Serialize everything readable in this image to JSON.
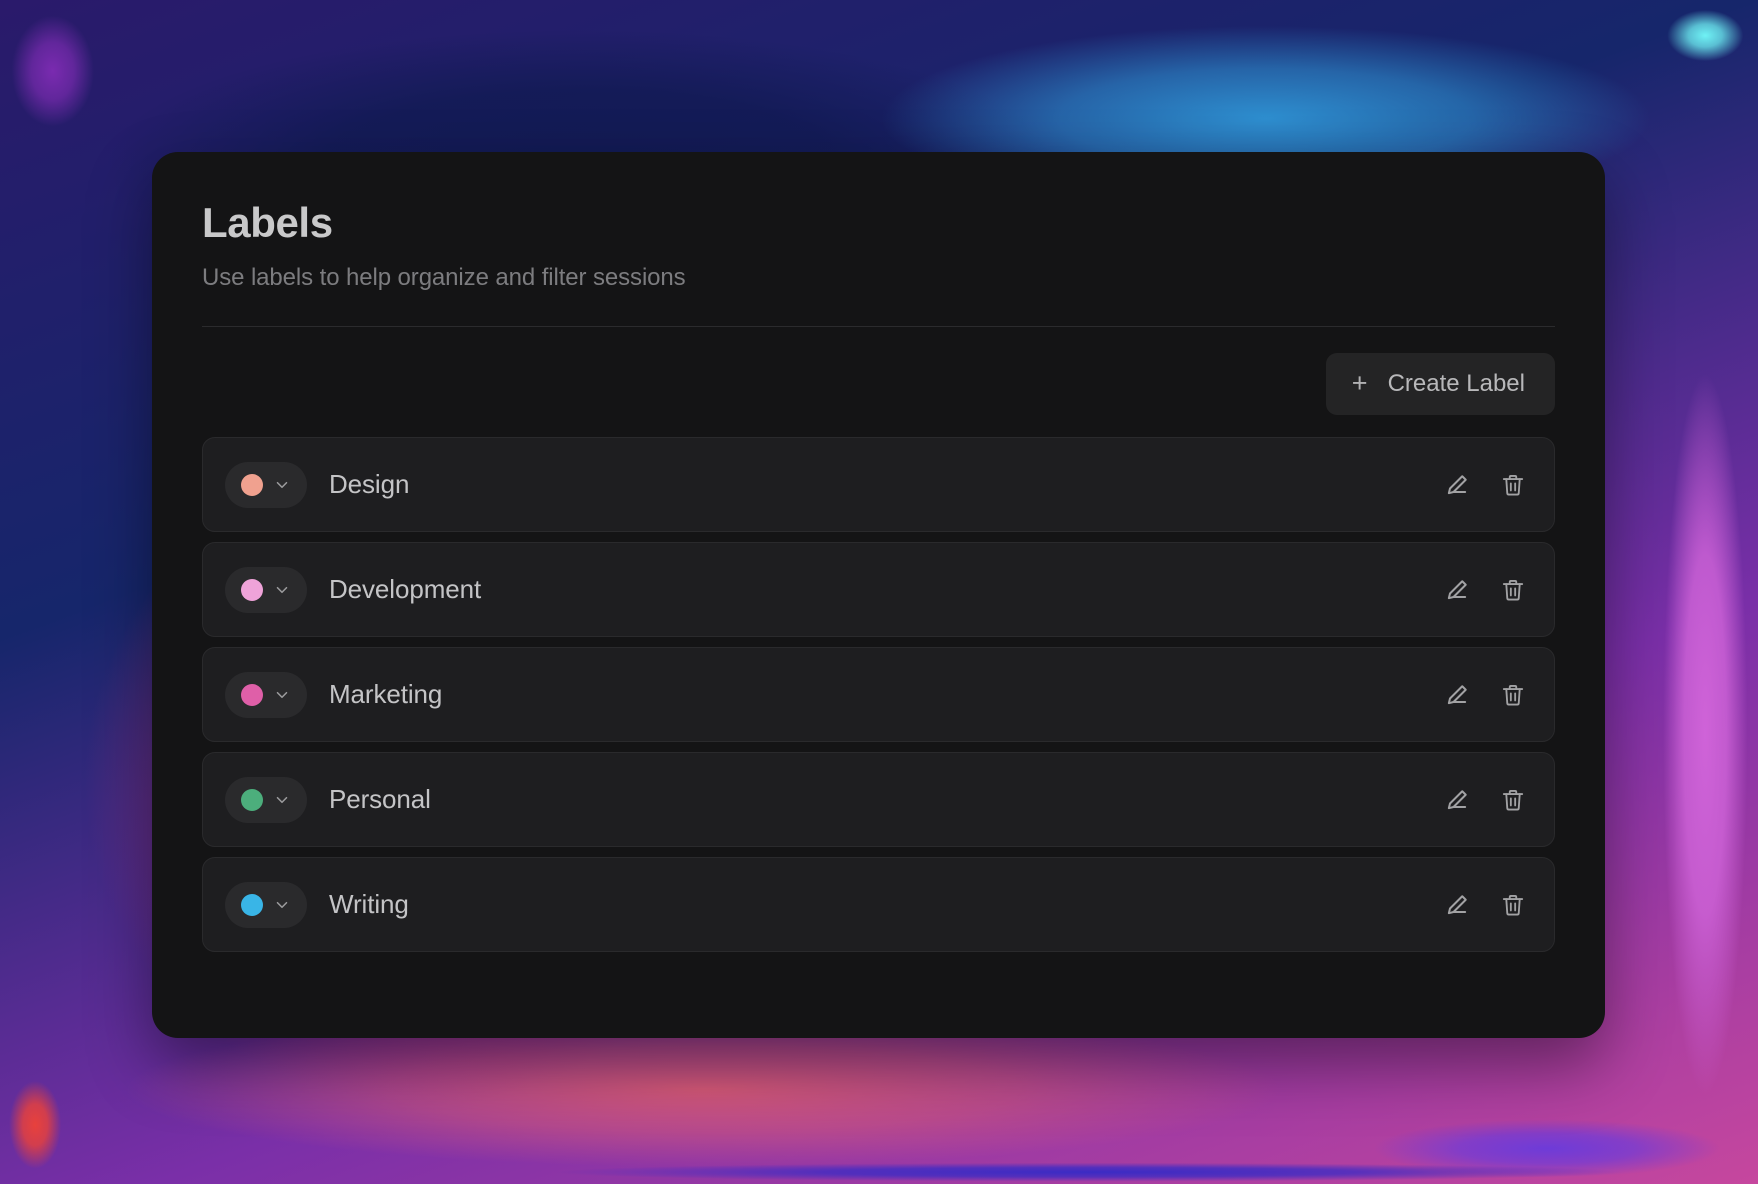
{
  "background": {
    "colors": [
      "#7a2bb0",
      "#121a54",
      "#6ff2f5",
      "#e8413c",
      "#cf63d8",
      "#3b2bc4"
    ]
  },
  "card": {
    "background_color": "#141415"
  },
  "header": {
    "title": "Labels",
    "subtitle": "Use labels to help organize and filter sessions"
  },
  "toolbar": {
    "create_label": {
      "label": "Create Label",
      "icon": "plus-icon",
      "icon_glyph": "+"
    }
  },
  "labels": [
    {
      "name": "Design",
      "color": "#f0a18f",
      "color_picker_icon": "chevron-down-icon",
      "edit_icon": "pencil-icon",
      "delete_icon": "trash-icon"
    },
    {
      "name": "Development",
      "color": "#efa3d9",
      "color_picker_icon": "chevron-down-icon",
      "edit_icon": "pencil-icon",
      "delete_icon": "trash-icon"
    },
    {
      "name": "Marketing",
      "color": "#df5fa8",
      "color_picker_icon": "chevron-down-icon",
      "edit_icon": "pencil-icon",
      "delete_icon": "trash-icon"
    },
    {
      "name": "Personal",
      "color": "#4cae7c",
      "color_picker_icon": "chevron-down-icon",
      "edit_icon": "pencil-icon",
      "delete_icon": "trash-icon"
    },
    {
      "name": "Writing",
      "color": "#39b5e7",
      "color_picker_icon": "chevron-down-icon",
      "edit_icon": "pencil-icon",
      "delete_icon": "trash-icon"
    }
  ]
}
